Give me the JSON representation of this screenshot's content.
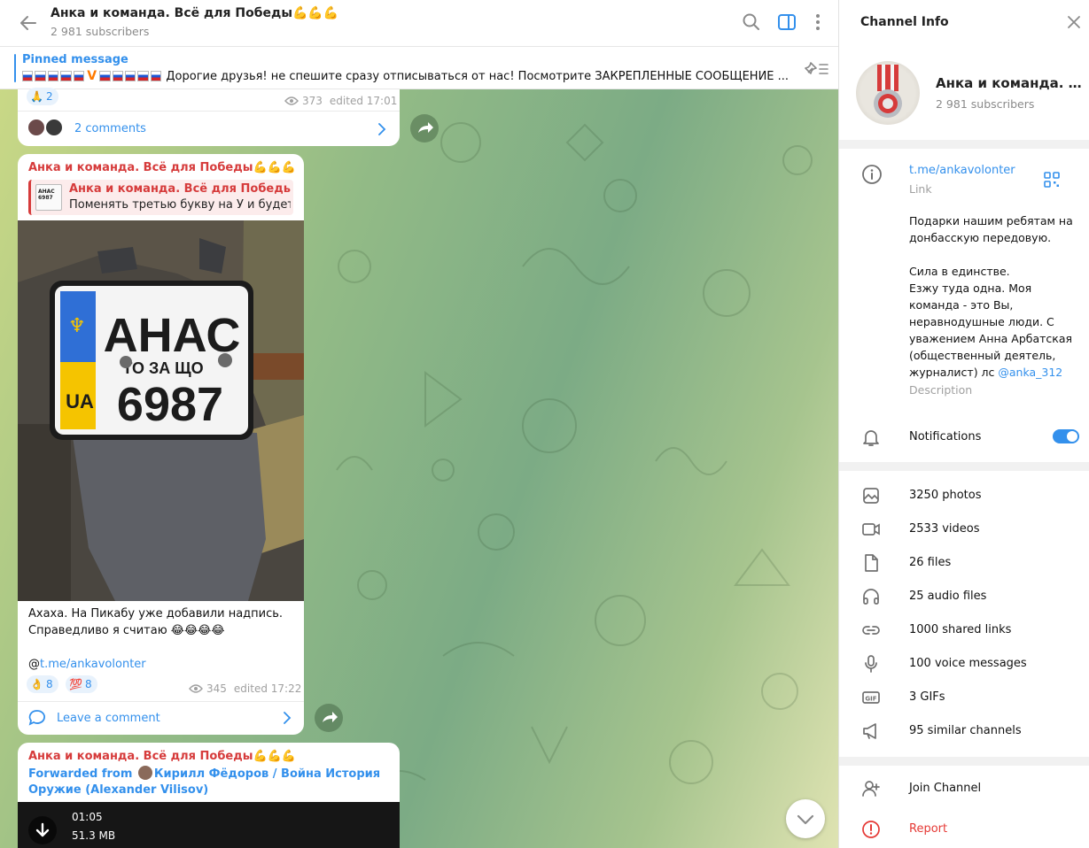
{
  "header": {
    "title": "Анка и команда. Всё для Победы💪💪💪",
    "subscribers": "2 981 subscribers"
  },
  "pinned": {
    "label": "Pinned message",
    "text": "Дорогие друзья! не спешите сразу отписываться от нас!  Посмотрите ЗАКРЕПЛЕННЫЕ СООБЩЕНИЕ ..."
  },
  "messages": {
    "top": {
      "reaction_emoji": "🙏",
      "reaction_count": "2",
      "views": "373",
      "edited": "edited 17:01",
      "comments": "2 comments"
    },
    "main": {
      "author": "Анка и команда. Всё для Победы💪💪💪",
      "reply_name": "Анка и команда. Всё для Победы💪💪💪",
      "reply_text": "Поменять третью  букву на У и будет ...",
      "plate_line1": "АНАС",
      "plate_line2": "ТО ЗА ЩО",
      "plate_line3": "6987",
      "plate_country": "UA",
      "text_line1": "Ахаха. На Пикабу уже добавили надпись.",
      "text_line2": "Справедливо я считаю 😂😂😂😂",
      "link_prefix": "@",
      "link": "t.me/ankavolonter",
      "reactions": [
        {
          "emoji": "👌",
          "count": "8"
        },
        {
          "emoji": "💯",
          "count": "8"
        }
      ],
      "views": "345",
      "edited": "edited 17:22",
      "leave_comment": "Leave a comment"
    },
    "bottom": {
      "author": "Анка и команда. Всё для Победы💪💪💪",
      "forwarded_prefix": "Forwarded from",
      "forwarded_name": "Кирилл Фёдоров / Война История Оружие (Alexander Vilisov)",
      "video_time": "01:05",
      "video_size": "51.3 MB"
    }
  },
  "panel": {
    "title": "Channel Info",
    "name": "Анка и команда. Всё для Победы💪💪💪",
    "subscribers": "2 981 subscribers",
    "link": "t.me/ankavolonter",
    "link_label": "Link",
    "description": "Подарки нашим ребятам на донбасскую передовую.\n\nСила в единстве.\n Езжу туда одна. Моя команда - это Вы, неравнодушные люди. С уважением Анна Арбатская (общественный деятель, журналист) лс ",
    "description_handle": "@anka_312",
    "description_label": "Description",
    "notifications": "Notifications",
    "media": [
      {
        "icon": "photo-icon",
        "label": "3250 photos"
      },
      {
        "icon": "video-icon",
        "label": "2533 videos"
      },
      {
        "icon": "file-icon",
        "label": "26 files"
      },
      {
        "icon": "headphones-icon",
        "label": "25 audio files"
      },
      {
        "icon": "link-icon",
        "label": "1000 shared links"
      },
      {
        "icon": "microphone-icon",
        "label": "100 voice messages"
      },
      {
        "icon": "gif-icon",
        "label": "3 GIFs"
      },
      {
        "icon": "megaphone-icon",
        "label": "95 similar channels"
      }
    ],
    "join": "Join Channel",
    "report": "Report"
  },
  "colors": {
    "accent": "#3390ec",
    "author": "#d63b3b",
    "report": "#e53935"
  }
}
